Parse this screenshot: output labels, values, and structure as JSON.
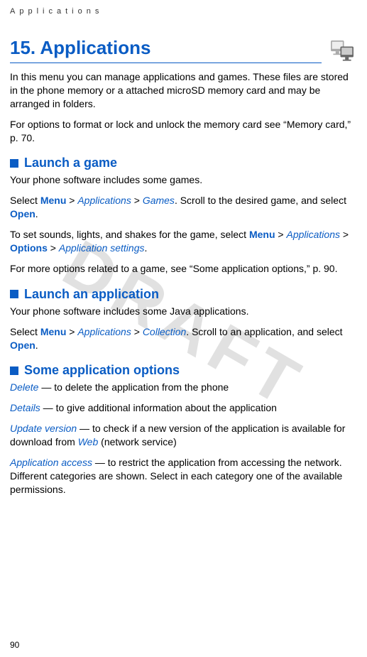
{
  "watermark": "DRAFT",
  "header_label": "Applications",
  "chapter_title": "15. Applications",
  "page_number": "90",
  "intro_p1": "In this menu you can manage applications and games. These files are stored in the phone memory or a attached microSD memory card and may be arranged in folders.",
  "intro_p2": "For options to format or lock and unlock the memory card see “Memory card,” p. 70.",
  "game": {
    "title": "Launch a game",
    "p1": "Your phone software includes some games.",
    "p2_select": "Select ",
    "p2_menu": "Menu",
    "p2_gt1": " > ",
    "p2_applications": "Applications",
    "p2_gt2": " > ",
    "p2_games": "Games",
    "p2_rest": ". Scroll to the desired game, and select ",
    "p2_open": "Open",
    "p2_dot": ".",
    "p3_pre": "To set sounds, lights, and shakes for the game, select ",
    "p3_menu": "Menu",
    "p3_gt1": " > ",
    "p3_applications": "Applications",
    "p3_gt2": " > ",
    "p3_options": "Options",
    "p3_gt3": " > ",
    "p3_appsettings": "Application settings",
    "p3_dot": ".",
    "p4": "For more options related to a game, see “Some application options,” p. 90."
  },
  "app": {
    "title": "Launch an application",
    "p1": "Your phone software includes some Java applications.",
    "p2_select": "Select ",
    "p2_menu": "Menu",
    "p2_gt1": " > ",
    "p2_applications": "Applications",
    "p2_gt2": " > ",
    "p2_collection": "Collection",
    "p2_rest": ". Scroll to an application, and select ",
    "p2_open": "Open",
    "p2_dot": "."
  },
  "opts": {
    "title": "Some application options",
    "delete_kw": "Delete",
    "delete_rest": " — to delete the application from the phone",
    "details_kw": "Details",
    "details_rest": " — to give additional information about the application",
    "update_kw": "Update version",
    "update_mid": " — to check if a new version of the application is available for download from ",
    "update_web": "Web",
    "update_end": " (network service)",
    "access_kw": "Application access",
    "access_rest": " — to restrict the application from accessing the network. Different categories are shown. Select in each category one of the available permissions."
  }
}
